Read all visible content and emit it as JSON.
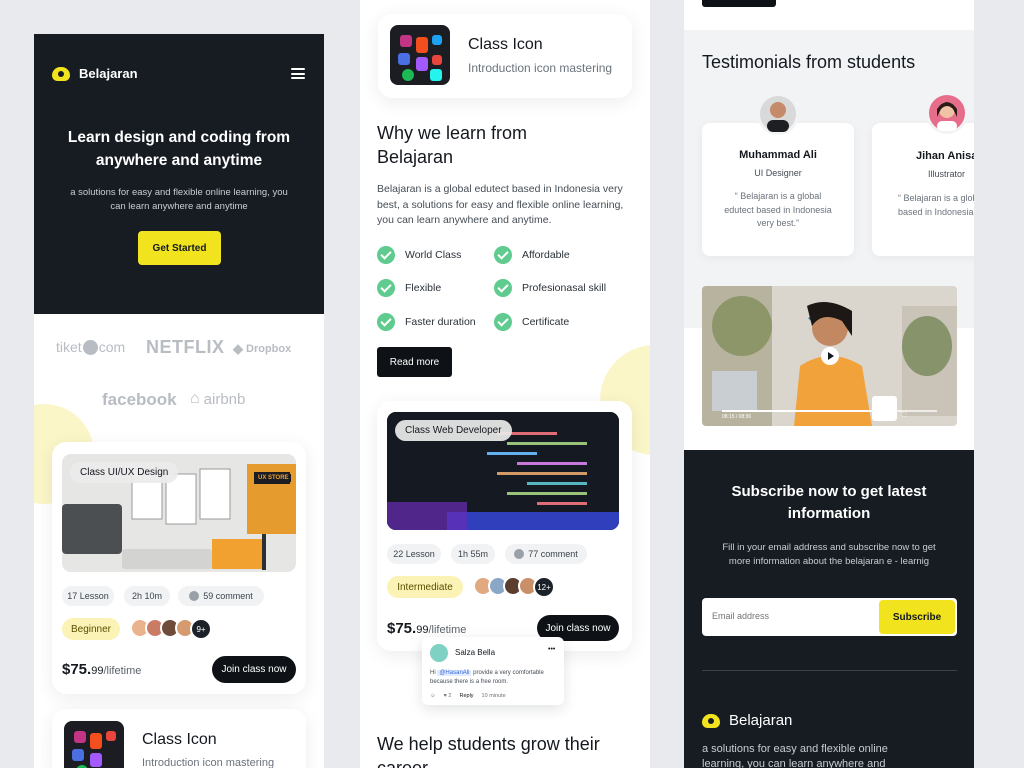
{
  "brand": {
    "name": "Belajaran",
    "accent": "#F2E31F",
    "dark": "#161C22",
    "check_color": "#5FCB8E"
  },
  "hero": {
    "title": "Learn design and coding from anywhere and anytime",
    "subtitle": "a solutions for easy and flexible online learning, you can learn anywhere and anytime",
    "cta": "Get Started"
  },
  "partners": [
    "tiket",
    "com",
    "NETFLIX",
    "Dropbox",
    "facebook",
    "airbnb"
  ],
  "course_uiux": {
    "tag": "Class UI/UX Design",
    "lessons": "17 Lesson",
    "duration": "2h 10m",
    "comments": "59 comment",
    "level": "Beginner",
    "more": "9+",
    "price_main": "$75.",
    "price_cents": "99",
    "price_per": "/lifetime",
    "cta": "Join class now",
    "thumb_label": "UX STORE"
  },
  "class_icon": {
    "title": "Class Icon",
    "subtitle": "Introduction icon mastering"
  },
  "why": {
    "title": "Why we learn from Belajaran",
    "body": "Belajaran is a global edutect based in Indonesia very best, a solutions for easy and flexible online learning, you can learn anywhere and anytime.",
    "features": [
      "World Class",
      "Affordable",
      "Flexible",
      "Profesionasal skill",
      "Faster duration",
      "Certificate"
    ],
    "read_more": "Read more"
  },
  "course_web": {
    "tag": "Class Web Developer",
    "lessons": "22 Lesson",
    "duration": "1h 55m",
    "comments": "77 comment",
    "level": "Intermediate",
    "more": "12+",
    "price_main": "$75.",
    "price_cents": "99",
    "price_per": "/lifetime",
    "cta": "Join class now"
  },
  "comment": {
    "author": "Salza Bella",
    "menu": "•••",
    "prefix": "Hi",
    "mention": "@HasanAli",
    "text": "provide a very comfortable because there is a free room.",
    "likes": "2",
    "reply": "Reply",
    "time": "10 minute"
  },
  "help": {
    "title": "We help students grow their career"
  },
  "testimonials": {
    "title": "Testimonials from students",
    "items": [
      {
        "name": "Muhammad Ali",
        "role": "UI Designer",
        "quote": "“ Belajaran is a global edutect based in Indonesia very best.”"
      },
      {
        "name": "Jihan Anisa",
        "role": "Illustrator",
        "quote": "“ Belajaran is a global edutect based in Indonesia very best.”"
      }
    ]
  },
  "video": {
    "time": "08:15 / 08:36"
  },
  "subscribe": {
    "title": "Subscribe now to get latest information",
    "body": "Fill in your email address and subscribe now to get more information about the belajaran e - learnig",
    "placeholder": "Email address",
    "button": "Subscribe"
  },
  "footer": {
    "brand": "Belajaran",
    "tagline": "a solutions for easy and flexible online learning, you can learn anywhere and anytime"
  }
}
